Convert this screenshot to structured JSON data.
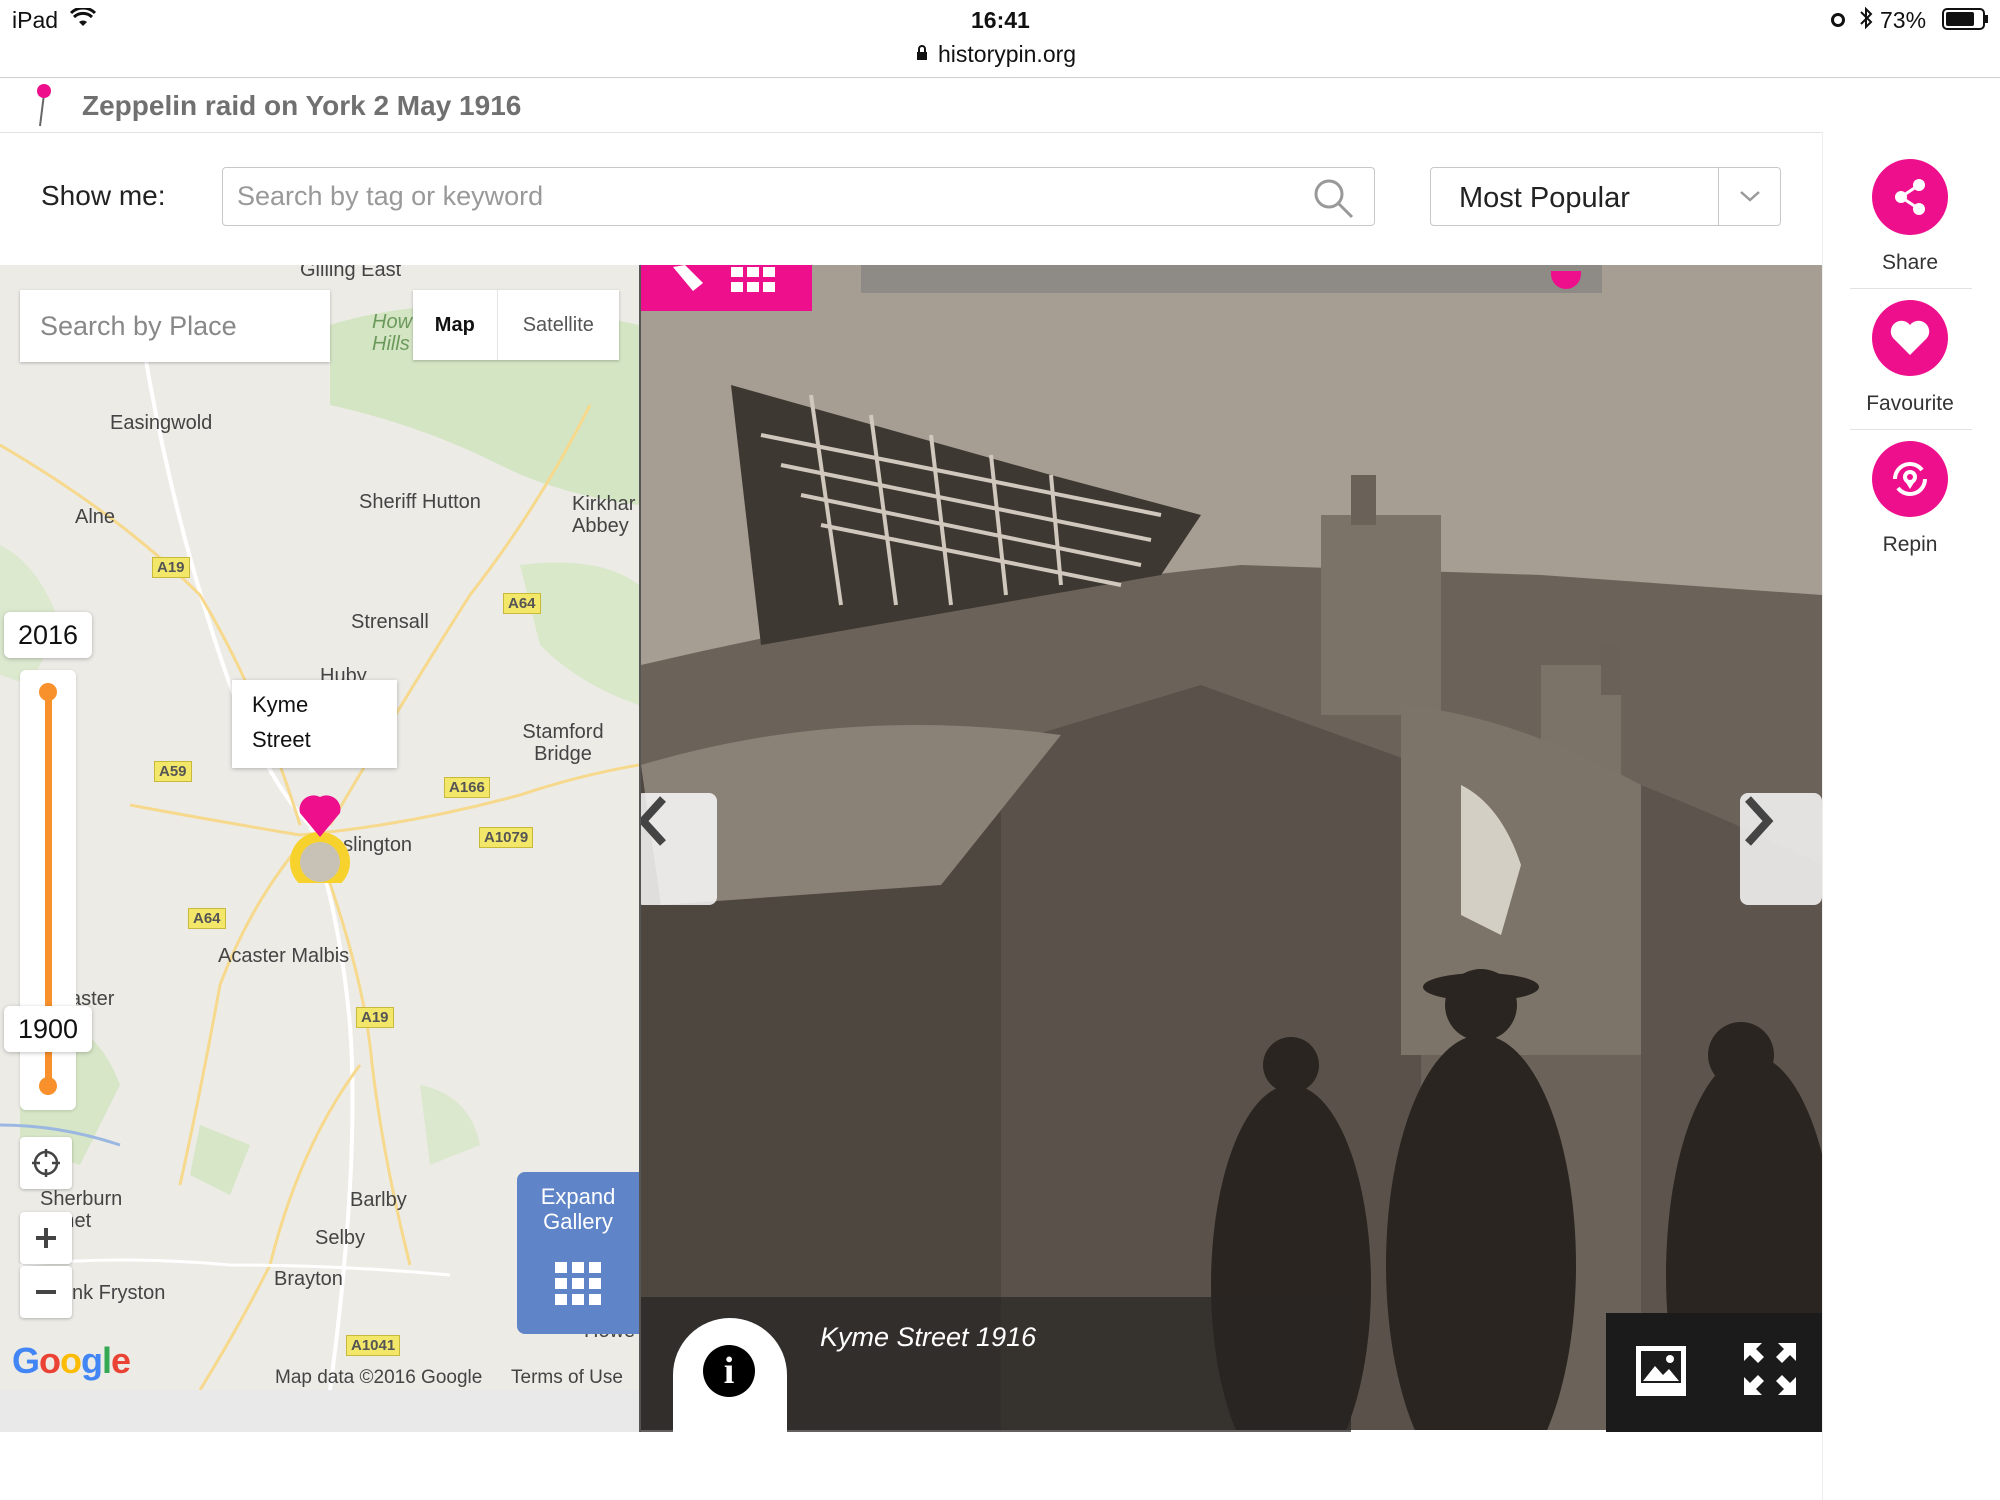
{
  "status_bar": {
    "device": "iPad",
    "time": "16:41",
    "url": "historypin.org",
    "battery": "73%"
  },
  "page": {
    "title": "Zeppelin raid on York 2 May 1916"
  },
  "filter": {
    "show_me_label": "Show me:",
    "search_placeholder": "Search by tag or keyword",
    "sort_selected": "Most Popular"
  },
  "actions": [
    {
      "label": "Share",
      "icon": "share-icon"
    },
    {
      "label": "Favourite",
      "icon": "heart-icon"
    },
    {
      "label": "Repin",
      "icon": "repin-icon"
    }
  ],
  "map": {
    "place_search_placeholder": "Search by Place",
    "map_type": {
      "map": "Map",
      "satellite": "Satellite"
    },
    "places": [
      "Gilling East",
      "Easingwold",
      "Alne",
      "Sheriff Hutton",
      "Kirkhar Abbey",
      "Strensall",
      "Huby",
      "Stamford Bridge",
      "eslington",
      "Acaster Malbis",
      "aster",
      "Sherburn Elmet",
      "Barlby",
      "Selby",
      "Brayton",
      "nk Fryston",
      "How Hills",
      "Howe"
    ],
    "roads": [
      "A19",
      "A64",
      "A59",
      "A166",
      "A1079",
      "A64",
      "A19",
      "A1041"
    ],
    "timeline": {
      "year_top": "2016",
      "year_bottom": "1900"
    },
    "tooltip": {
      "line1": "Kyme",
      "line2": "Street"
    },
    "expand_gallery": {
      "line1": "Expand",
      "line2": "Gallery"
    },
    "attribution": {
      "logo": "Google",
      "data": "Map data ©2016 Google",
      "terms": "Terms of Use"
    }
  },
  "photo": {
    "caption": "Kyme Street 1916"
  },
  "colors": {
    "accent": "#ee0f8d",
    "timeline": "#f8902c",
    "gallery": "#5f85c8"
  }
}
